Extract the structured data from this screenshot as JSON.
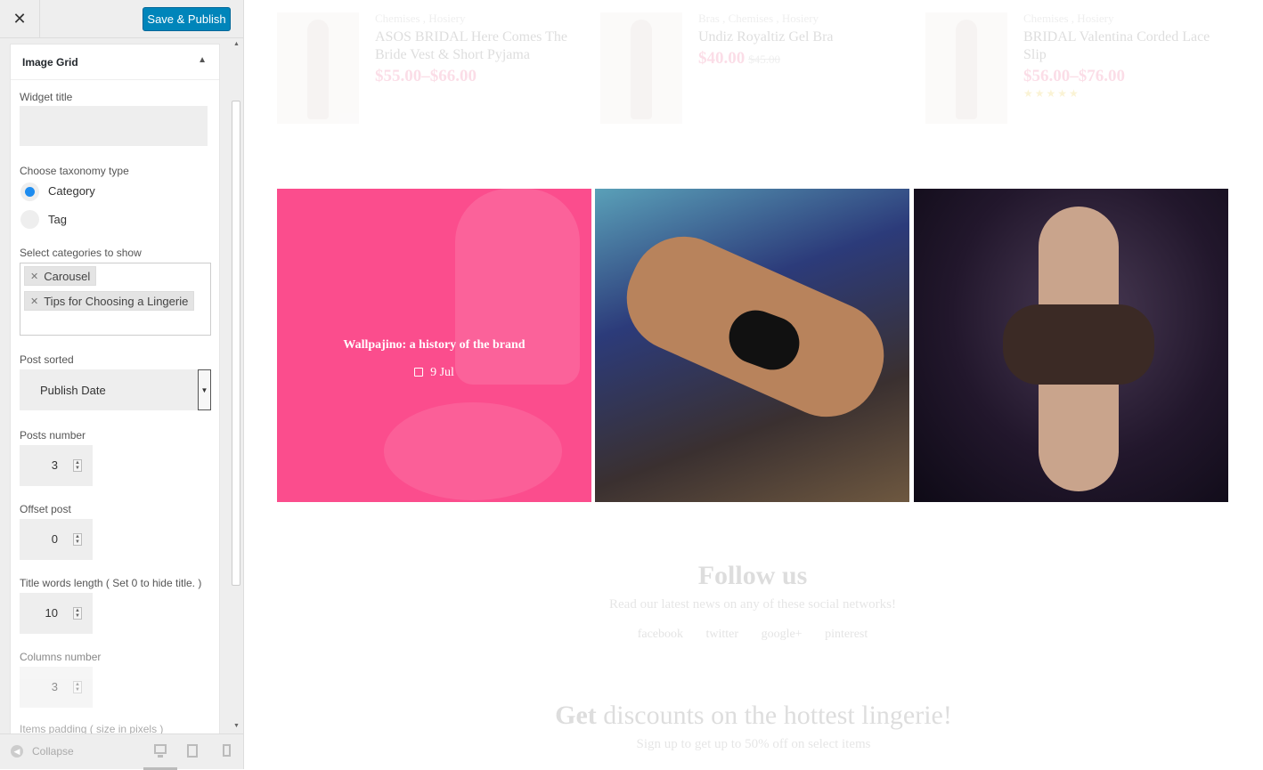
{
  "topbar": {
    "close_glyph": "✕",
    "publish_label": "Save & Publish"
  },
  "widget": {
    "title": "Image Grid",
    "toggle_glyph": "▲",
    "fields": {
      "widget_title_label": "Widget title",
      "widget_title_value": "",
      "taxonomy_label": "Choose taxonomy type",
      "taxonomy_options": [
        "Category",
        "Tag"
      ],
      "taxonomy_selected": "Category",
      "categories_label": "Select categories to show",
      "categories_selected": [
        "Carousel",
        "Tips for Choosing a Lingerie"
      ],
      "post_sorted_label": "Post sorted",
      "post_sorted_value": "Publish Date",
      "posts_number_label": "Posts number",
      "posts_number_value": "3",
      "offset_label": "Offset post",
      "offset_value": "0",
      "title_words_label": "Title words length ( Set 0 to hide title. )",
      "title_words_value": "10",
      "columns_label": "Columns number",
      "columns_value": "3",
      "padding_label": "Items padding ( size in pixels )"
    }
  },
  "footer": {
    "collapse_label": "Collapse"
  },
  "preview": {
    "products": [
      {
        "cats": "Chemises , Hosiery",
        "name": "ASOS BRIDAL Here Comes The Bride Vest & Short Pyjama",
        "price": "$55.00–$66.00",
        "old_price": ""
      },
      {
        "cats": "Bras , Chemises , Hosiery",
        "name": "Undiz Royaltiz Gel Bra",
        "price": "$40.00",
        "old_price": "$45.00"
      },
      {
        "cats": "Chemises , Hosiery",
        "name": "BRIDAL Valentina Corded Lace Slip",
        "price": "$56.00–$76.00",
        "old_price": "",
        "stars": "★★★★★"
      }
    ],
    "grid_post": {
      "title": "Wallpajino: a history of the brand",
      "date": "9 Jul"
    },
    "follow": {
      "title": "Follow us",
      "subtitle": "Read our latest news on any of these social networks!",
      "links": [
        "facebook",
        "twitter",
        "google+",
        "pinterest"
      ]
    },
    "discount": {
      "title_bold": "Get",
      "title_rest": " discounts on the hottest lingerie!",
      "subtitle": "Sign up to get up to 50% off on select items"
    }
  },
  "colors": {
    "accent": "#0085ba",
    "pink": "#fb4d8d",
    "radio": "#1e8cef",
    "price": "#e8336d"
  }
}
